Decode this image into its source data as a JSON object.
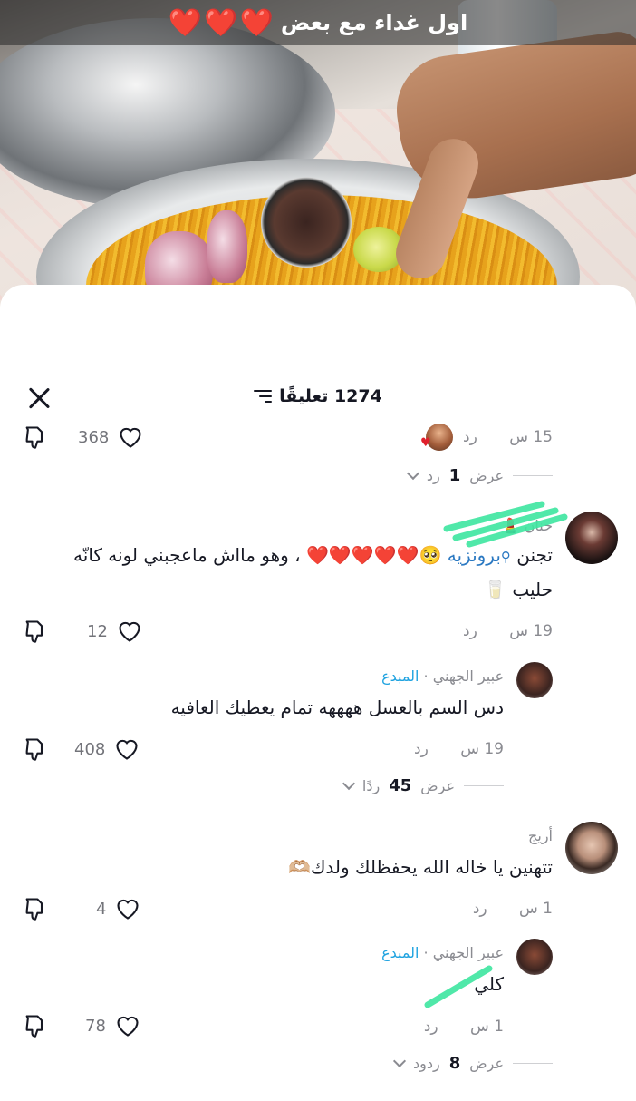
{
  "video": {
    "caption": "اول غداء مع بعض",
    "caption_hearts": "❤️❤️❤️"
  },
  "sheet": {
    "comment_count": "1274 تعليقًا"
  },
  "comments": [
    {
      "time": "15 س",
      "reply_label": "رد",
      "likes": "368",
      "view_replies": {
        "prefix": "عرض",
        "count": "1",
        "suffix": "رد"
      }
    },
    {
      "username": "حنان",
      "emoji_after_name": "💄",
      "text_start": "تجنن ",
      "mention": "برونزيه",
      "text_end": "🥺❤️❤️❤️❤️❤️ ، وهو مااش ماعجبني لونه كانّه حليب 🥛",
      "time": "19 س",
      "reply_label": "رد",
      "likes": "12"
    },
    {
      "username": "عبير الجهني",
      "badge": "المبدع",
      "text": "دس السم بالعسل ههههه تمام يعطيك العافيه",
      "time": "19 س",
      "reply_label": "رد",
      "likes": "408",
      "view_replies": {
        "prefix": "عرض",
        "count": "45",
        "suffix": "ردًا"
      }
    },
    {
      "username": "أريج",
      "text": "تتهنين يا خاله الله يحفظلك ولدك🫶🏼",
      "time": "1 س",
      "reply_label": "رد",
      "likes": "4"
    },
    {
      "username": "عبير الجهني",
      "badge": "المبدع",
      "text": "كلي",
      "time": "1 س",
      "reply_label": "رد",
      "likes": "78",
      "view_replies": {
        "prefix": "عرض",
        "count": "8",
        "suffix": "ردود"
      }
    }
  ],
  "colors": {
    "accent_creator": "#20a3e0",
    "mention": "#2b79c2",
    "heart_red": "#e0202c",
    "highlight_green": "#3ee6a0"
  }
}
